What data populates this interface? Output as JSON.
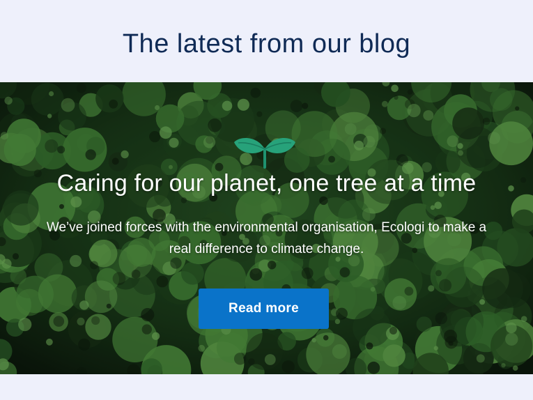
{
  "section": {
    "title": "The latest from our blog"
  },
  "hero": {
    "background": "aerial-forest-image",
    "icon": "sprout-icon",
    "title": "Caring for our planet, one tree at a time",
    "body": "We’ve joined forces with the environmental organisation, Ecologi to make a real difference to climate change.",
    "button_label": "Read more"
  },
  "colors": {
    "page_background": "#eef0fb",
    "title": "#0f2a55",
    "button": "#0a73c9",
    "sprout": "#27a27a"
  }
}
